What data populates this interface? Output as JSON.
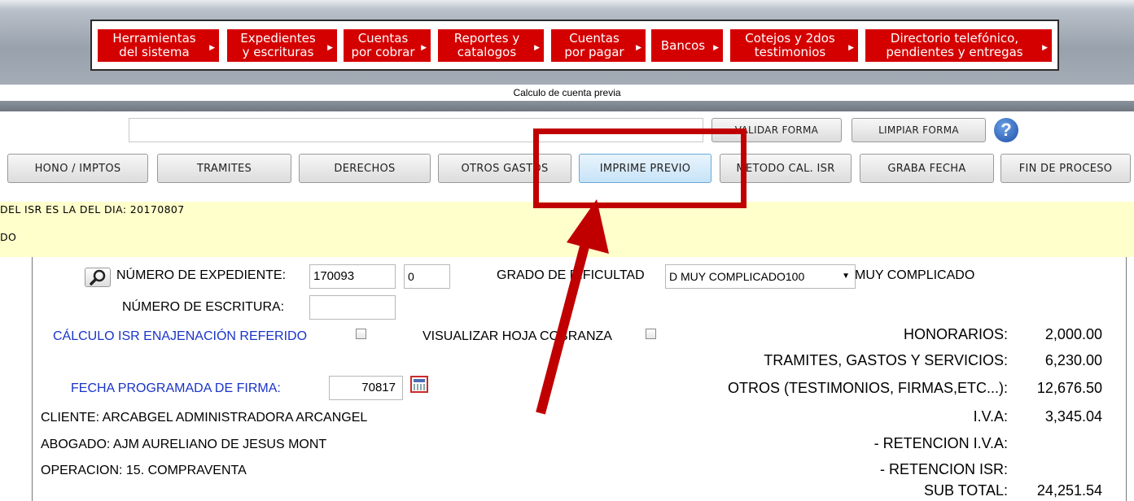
{
  "menu": {
    "items": [
      {
        "label": "Herramientas\ndel sistema"
      },
      {
        "label": "Expedientes\ny escrituras"
      },
      {
        "label": "Cuentas\npor cobrar"
      },
      {
        "label": "Reportes y\ncatalogos"
      },
      {
        "label": "Cuentas\npor pagar"
      },
      {
        "label": "Bancos"
      },
      {
        "label": "Cotejos y 2dos\ntestimonios"
      },
      {
        "label": "Directorio telefónico,\npendientes y entregas"
      }
    ]
  },
  "page_title": "Calculo de cuenta previa",
  "toolbar": {
    "validar_label": "VALIDAR FORMA",
    "limpiar_label": "LIMPIAR FORMA",
    "help_label": "?"
  },
  "actions": [
    {
      "label": "HONO / IMPTOS"
    },
    {
      "label": "TRAMITES"
    },
    {
      "label": "DERECHOS"
    },
    {
      "label": "OTROS GASTOS"
    },
    {
      "label": "IMPRIME PREVIO"
    },
    {
      "label": "METODO CAL. ISR"
    },
    {
      "label": "GRABA FECHA"
    },
    {
      "label": "FIN DE PROCESO"
    }
  ],
  "messages": {
    "line1": "DEL ISR ES LA DEL DIA: 20170807",
    "line2": "DO"
  },
  "form": {
    "expediente_label": "NÚMERO DE EXPEDIENTE:",
    "expediente_value": "170093",
    "expediente_sub_value": "0",
    "dificultad_label": "GRADO DE DIFICULTAD",
    "dificultad_selected": "D MUY COMPLICADO100",
    "dificultad_desc": "MUY COMPLICADO",
    "escritura_label": "NÚMERO DE ESCRITURA:",
    "escritura_value": "",
    "isr_enajenacion_label": "CÁLCULO ISR ENAJENACIÓN REFERIDO",
    "visualizar_label": "VISUALIZAR HOJA COBRANZA",
    "fecha_label": "FECHA PROGRAMADA DE FIRMA:",
    "fecha_value": "70817",
    "cliente": "CLIENTE:  ARCABGEL  ADMINISTRADORA ARCANGEL",
    "abogado": "ABOGADO:  AJM  AURELIANO DE JESUS MONT",
    "operacion": "OPERACION:  15.  COMPRAVENTA"
  },
  "totals": [
    {
      "label": "HONORARIOS:",
      "value": "2,000.00"
    },
    {
      "label": "TRAMITES, GASTOS Y SERVICIOS:",
      "value": "6,230.00"
    },
    {
      "label": "OTROS (TESTIMONIOS, FIRMAS,ETC...):",
      "value": "12,676.50"
    },
    {
      "label": "I.V.A:",
      "value": "3,345.04"
    },
    {
      "label": "- RETENCION I.V.A:",
      "value": ""
    },
    {
      "label": "- RETENCION ISR:",
      "value": ""
    },
    {
      "label": "SUB TOTAL:",
      "value": "24,251.54"
    }
  ],
  "colors": {
    "menu_red": "#d40000",
    "annotation_red": "#c00000",
    "message_bg": "#ffffcc",
    "link_blue": "#1a34c8"
  }
}
